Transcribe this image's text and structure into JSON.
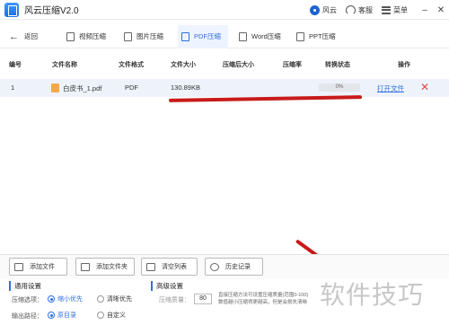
{
  "app": {
    "title": "风云压缩V2.0"
  },
  "titlebar_right": {
    "brand": "风云",
    "service": "客服",
    "menu": "菜单",
    "minimize": "–",
    "close": "✕"
  },
  "nav": {
    "back": "返回",
    "tabs": [
      {
        "label": "视频压缩",
        "active": false
      },
      {
        "label": "图片压缩",
        "active": false
      },
      {
        "label": "PDF压缩",
        "active": true
      },
      {
        "label": "Word压缩",
        "active": false
      },
      {
        "label": "PPT压缩",
        "active": false
      }
    ]
  },
  "table": {
    "headers": [
      "编号",
      "文件名称",
      "文件格式",
      "文件大小",
      "压缩后大小",
      "压缩率",
      "转换状态",
      "操作"
    ],
    "rows": [
      {
        "index": "1",
        "name": "白皮书_1.pdf",
        "format": "PDF",
        "size": "130.89KB",
        "compressed_size": "",
        "ratio": "",
        "progress_percent": 0,
        "progress_text": "0%",
        "open": "打开文件",
        "delete": "✕"
      }
    ]
  },
  "bottom_toolbar": {
    "add_file": "添加文件",
    "add_folder": "添加文件夹",
    "clear_list": "清空列表",
    "history": "历史记录"
  },
  "settings": {
    "general_title": "通用设置",
    "advanced_title": "高级设置",
    "compress_option_label": "压缩选项：",
    "option_small": "缩小优先",
    "option_clear": "清晰优先",
    "output_label": "输出路径：",
    "output_original": "原目录",
    "output_custom": "自定义",
    "quality_label": "压缩质量：",
    "quality_value": "80",
    "note_line1": "直接压缩方法可设置压缩质量(范围0-100)",
    "note_line2": "数值越小压缩得更越高，但是会损失清晰"
  },
  "watermark": "软件技巧",
  "colors": {
    "accent": "#2f6fe0",
    "annotation": "#c81a1a",
    "delete": "#e04848"
  }
}
